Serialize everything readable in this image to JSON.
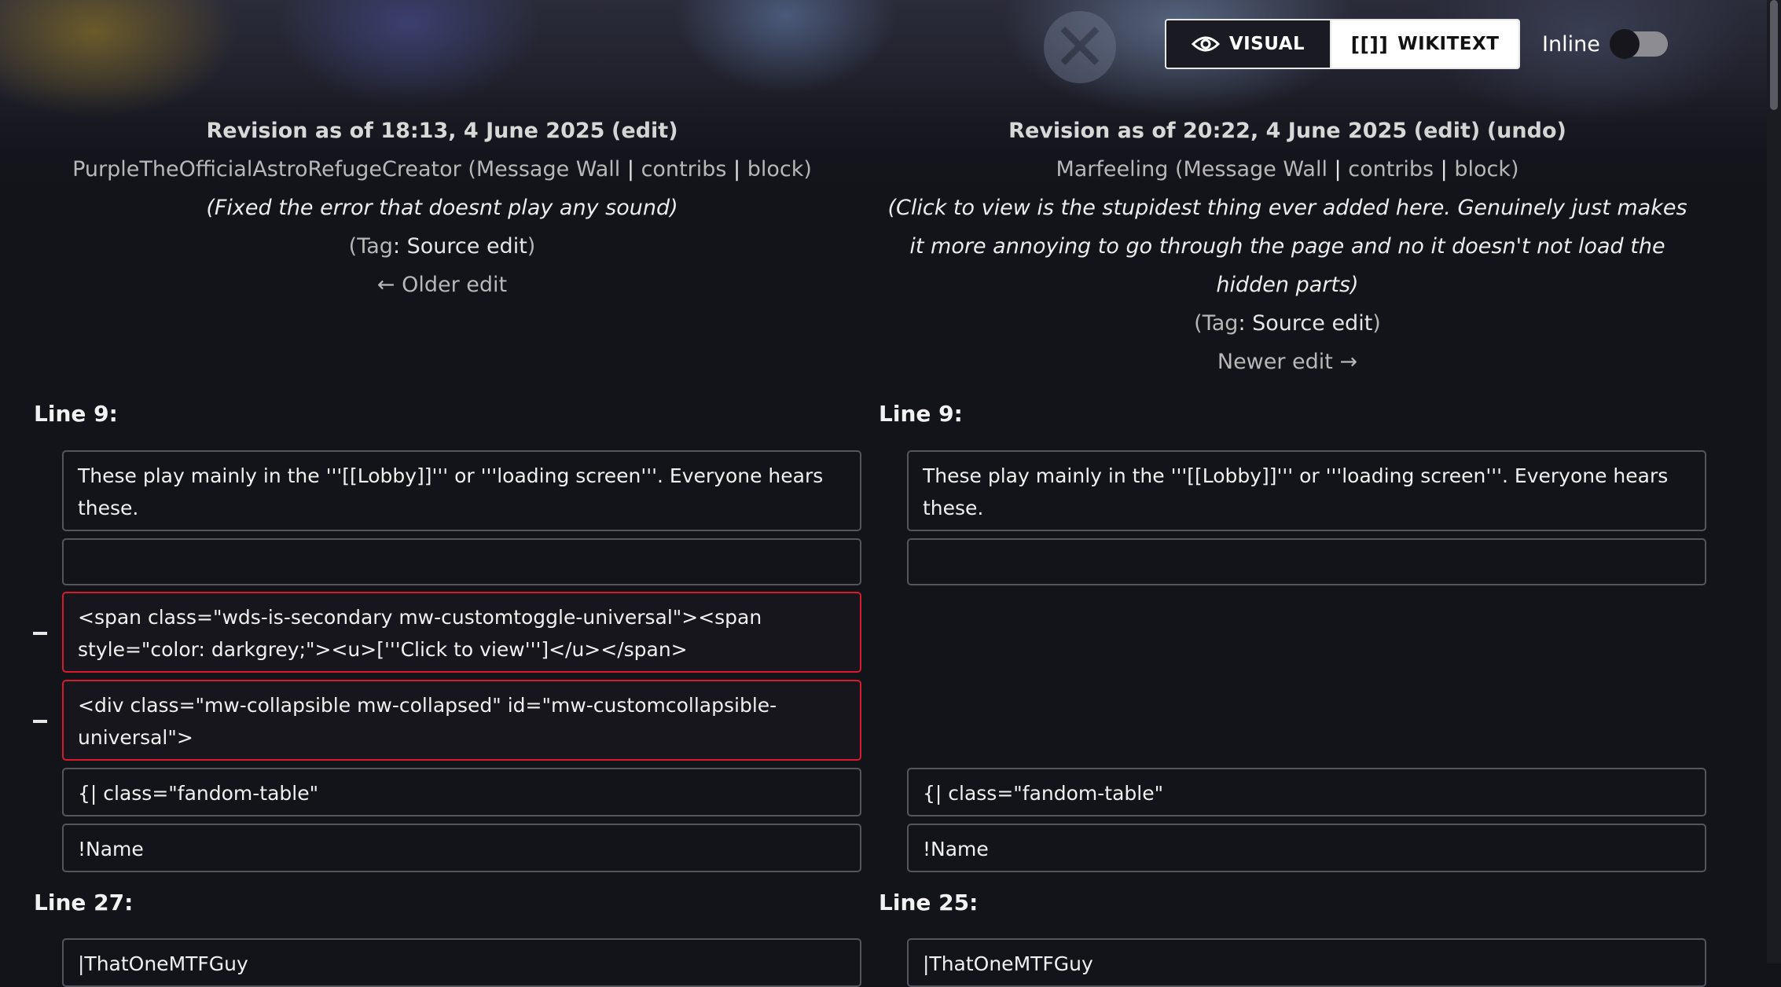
{
  "toolbar": {
    "visual_label": "VISUAL",
    "wikitext_label": "WIKITEXT",
    "inline_label": "Inline",
    "inline_on": false
  },
  "left_revision": {
    "title": "Revision as of 18:13, 4 June 2025",
    "edit_link": "(edit)",
    "user": "PurpleTheOfficialAstroRefugeCreator",
    "message_wall": "Message Wall",
    "contribs": "contribs",
    "block": "block",
    "summary": "(Fixed the error that doesnt play any sound)",
    "tag_label": "Tag",
    "tag_value": "Source edit",
    "nav": "← Older edit"
  },
  "right_revision": {
    "title": "Revision as of 20:22, 4 June 2025",
    "edit_link": "(edit)",
    "undo_link": "(undo)",
    "user": "Marfeeling",
    "message_wall": "Message Wall",
    "contribs": "contribs",
    "block": "block",
    "summary": "(Click to view is the stupidest thing ever added here. Genuinely just makes it more annoying to go through the page and no it doesn't not load the hidden parts)",
    "tag_label": "Tag",
    "tag_value": "Source edit",
    "nav": "Newer edit →"
  },
  "diff": {
    "left_line_head_1": "Line 9:",
    "right_line_head_1": "Line 9:",
    "left_line_head_2": "Line 27:",
    "right_line_head_2": "Line 25:",
    "context_1": "These play mainly in the '''[[Lobby]]''' or '''loading screen'''. Everyone hears these.",
    "context_2": "",
    "removed_1": "<span class=\"wds-is-secondary mw-customtoggle-universal\"><span style=\"color: darkgrey;\"><u>['''Click to view''']</u></span>",
    "removed_2": "<div class=\"mw-collapsible mw-collapsed\" id=\"mw-customcollapsible-universal\">",
    "context_3": "{| class=\"fandom-table\"",
    "context_4": "!Name",
    "context_5": "|ThatOneMTFGuy"
  }
}
